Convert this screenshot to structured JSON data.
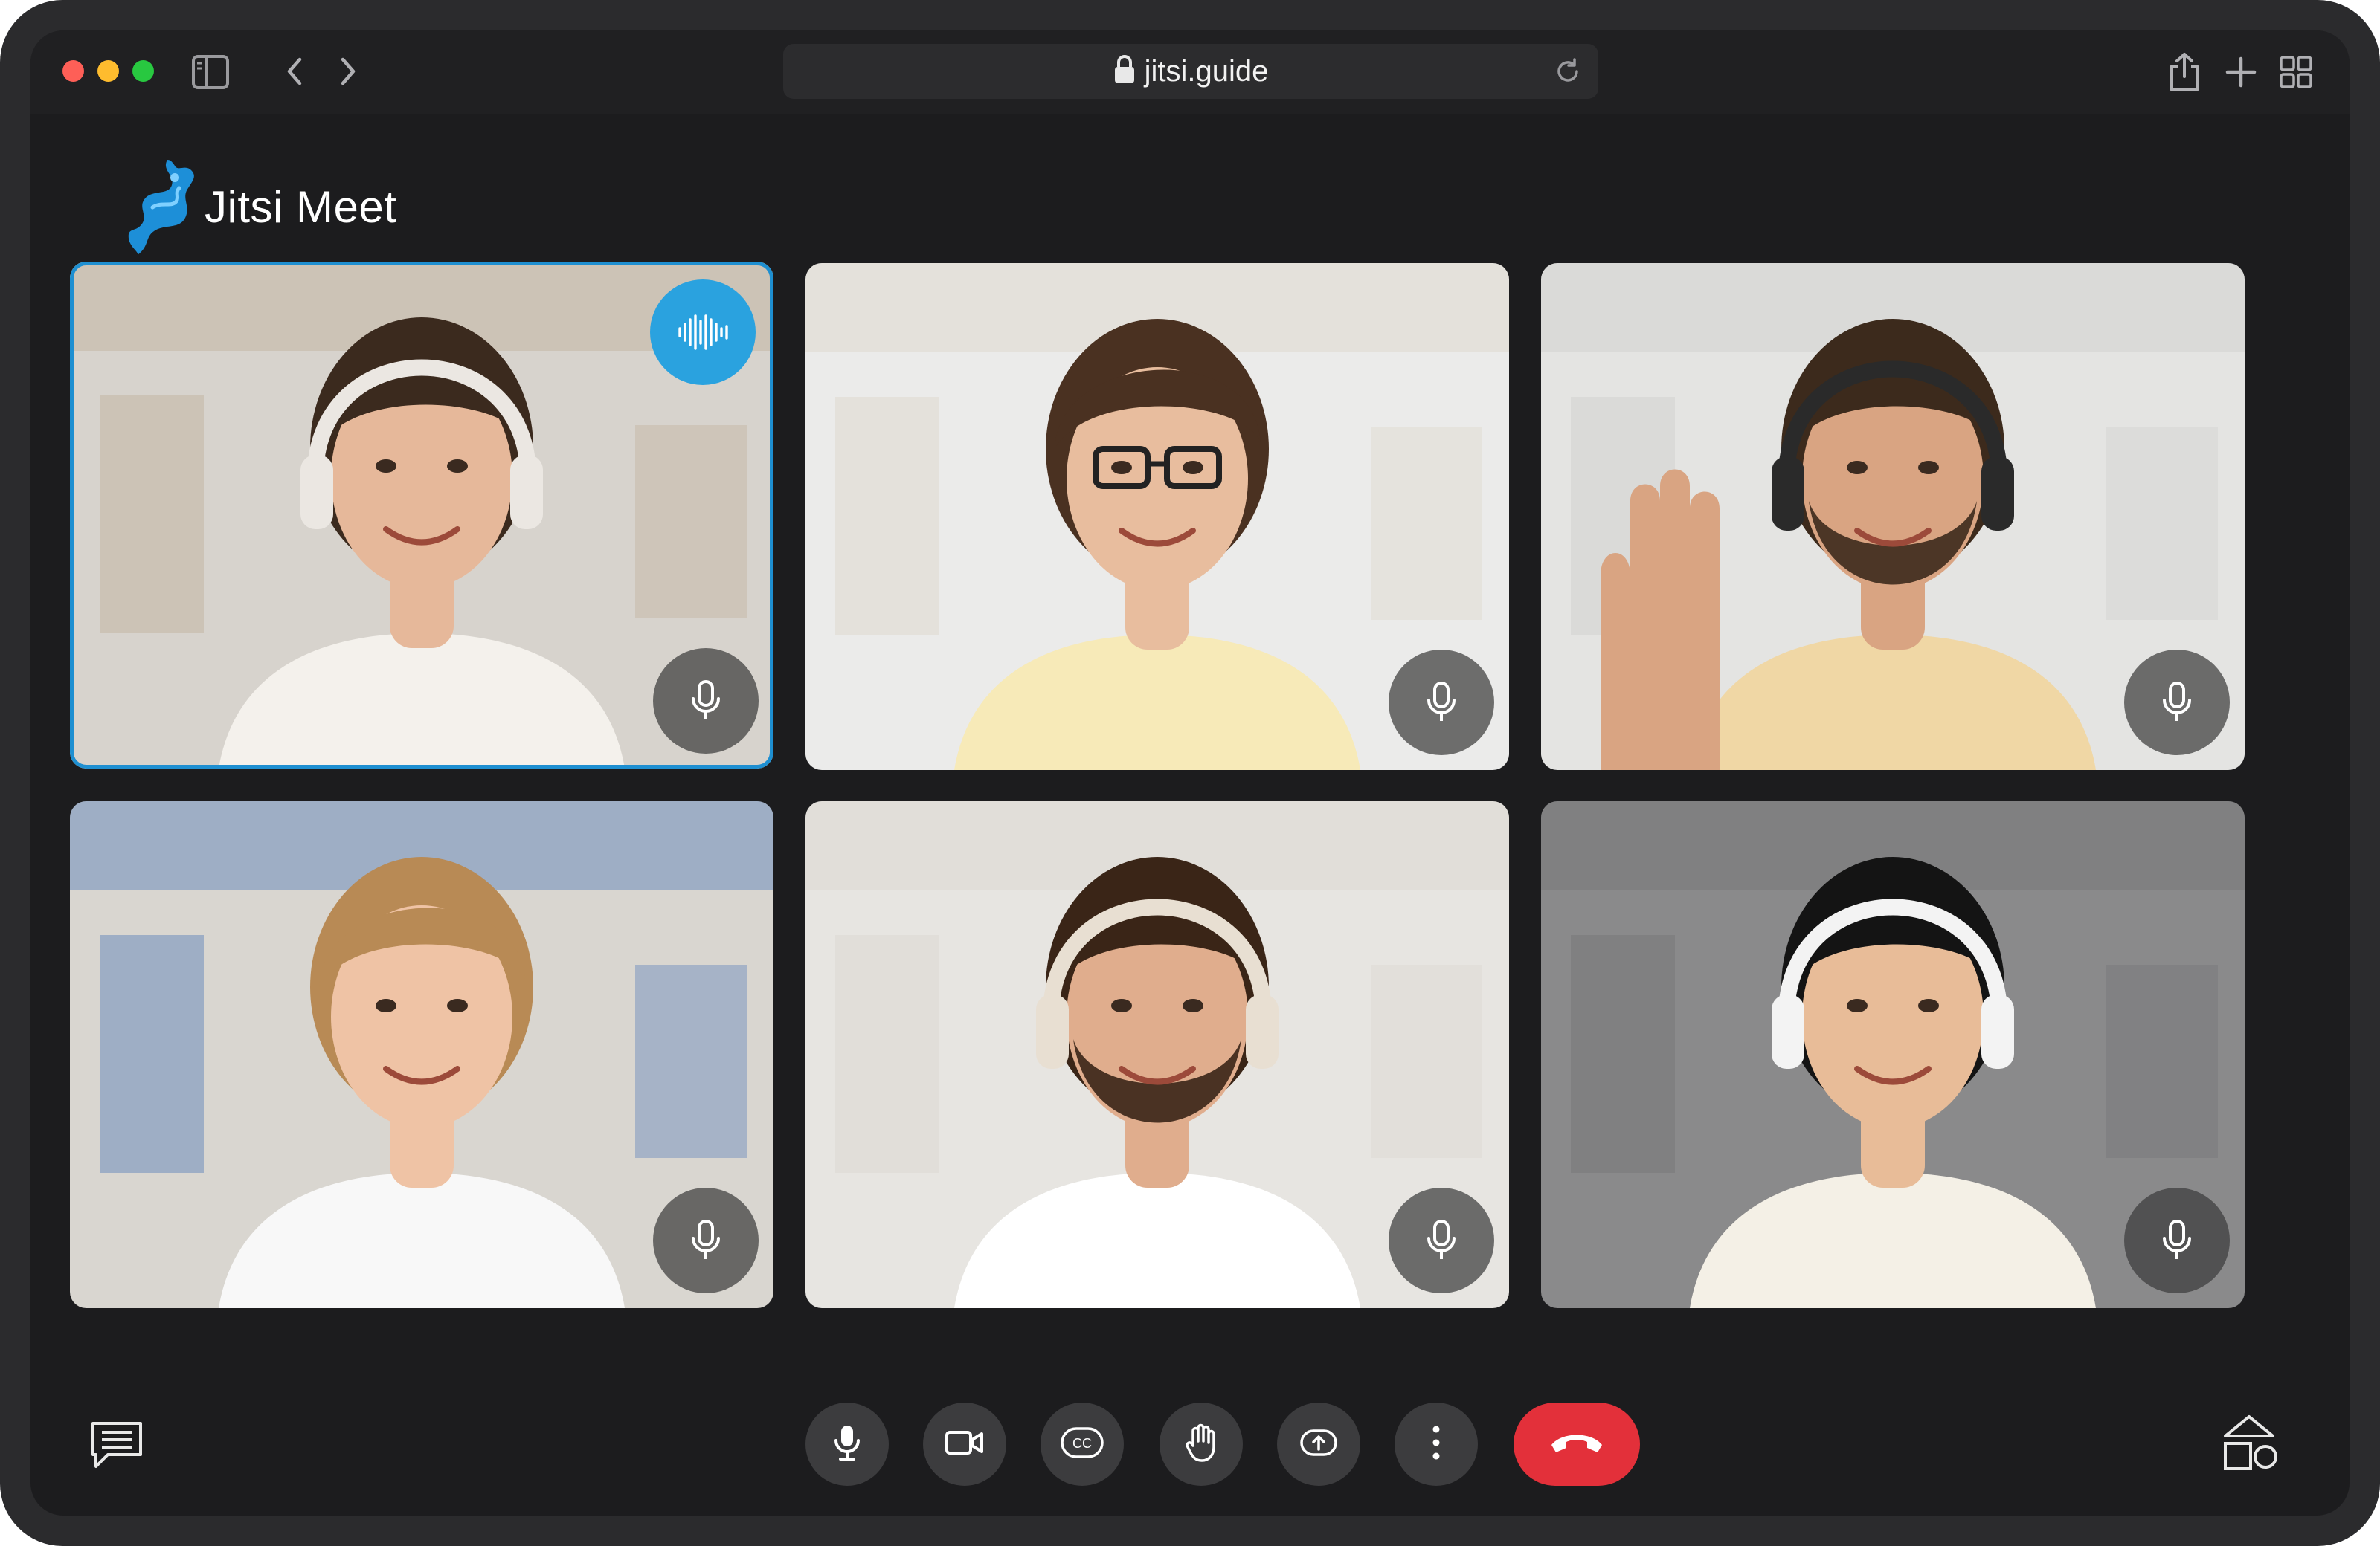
{
  "browser": {
    "url": "jitsi.guide",
    "icons": [
      "sidebar-icon",
      "back-icon",
      "forward-icon",
      "lock-icon",
      "reload-icon",
      "share-icon",
      "new-tab-icon",
      "tab-overview-icon"
    ]
  },
  "app": {
    "name": "Jitsi Meet",
    "accent": "#1e8fd1"
  },
  "participants": [
    {
      "active_speaker": true,
      "mic_icon": "microphone-icon",
      "speaking_icon": "audio-wave-icon"
    },
    {
      "active_speaker": false,
      "mic_icon": "microphone-icon"
    },
    {
      "active_speaker": false,
      "mic_icon": "microphone-icon"
    },
    {
      "active_speaker": false,
      "mic_icon": "microphone-icon"
    },
    {
      "active_speaker": false,
      "mic_icon": "microphone-icon"
    },
    {
      "active_speaker": false,
      "mic_icon": "microphone-icon"
    }
  ],
  "toolbar": {
    "buttons": [
      "microphone-icon",
      "camera-icon",
      "closed-captions-icon",
      "raise-hand-icon",
      "share-screen-icon",
      "more-options-icon"
    ],
    "hangup_color": "#e3303a",
    "left_icon": "chat-icon",
    "right_icon": "shapes-icon"
  },
  "colors": {
    "background": "#1c1c1e",
    "tile_badge": "#3c3c3e",
    "speaking_badge": "#2aa2df"
  }
}
